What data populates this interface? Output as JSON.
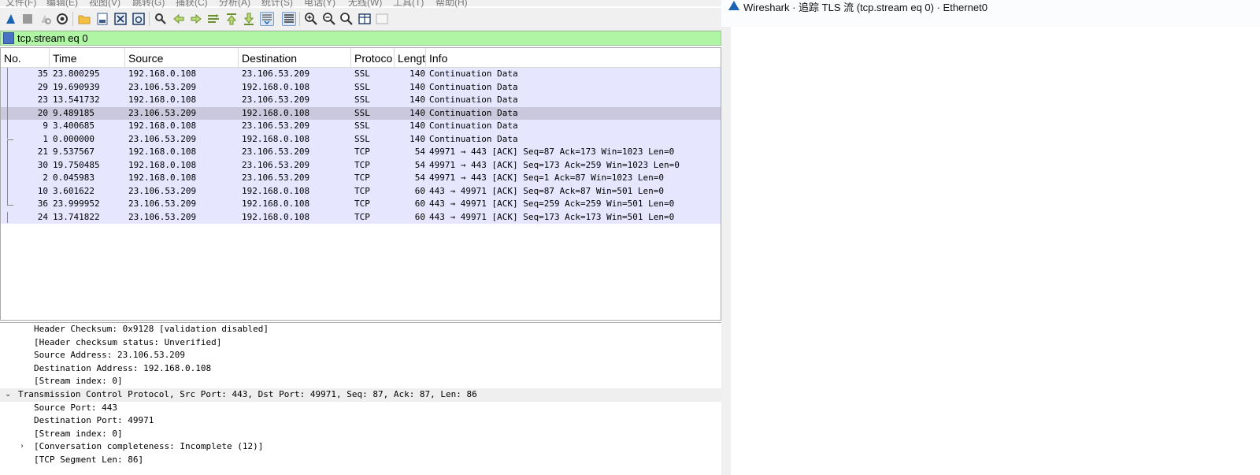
{
  "menubar": {
    "items": [
      "文件(F)",
      "编辑(E)",
      "视图(V)",
      "跳转(G)",
      "捕获(C)",
      "分析(A)",
      "统计(S)",
      "电话(Y)",
      "无线(W)",
      "工具(T)",
      "帮助(H)"
    ]
  },
  "toolbar": {
    "icons": [
      "start-capture-icon",
      "stop-capture-icon",
      "restart-capture-icon",
      "capture-options-icon",
      "open-file-icon",
      "save-file-icon",
      "close-file-icon",
      "reload-file-icon",
      "find-packet-icon",
      "go-back-icon",
      "go-forward-icon",
      "go-to-packet-icon",
      "go-first-icon",
      "go-last-icon",
      "autoscroll-icon",
      "colorize-icon",
      "zoom-in-icon",
      "zoom-out-icon",
      "zoom-normal-icon",
      "resize-columns-icon"
    ]
  },
  "filter": {
    "value": "tcp.stream eq 0"
  },
  "packet_list": {
    "columns": [
      "No.",
      "Time",
      "Source",
      "Destination",
      "Protoco",
      "Lengt",
      "Info"
    ],
    "rows": [
      {
        "no": "35",
        "time": "23.800295",
        "src": "192.168.0.108",
        "dst": "23.106.53.209",
        "proto": "SSL",
        "len": "140",
        "info": "Continuation Data"
      },
      {
        "no": "29",
        "time": "19.690939",
        "src": "23.106.53.209",
        "dst": "192.168.0.108",
        "proto": "SSL",
        "len": "140",
        "info": "Continuation Data"
      },
      {
        "no": "23",
        "time": "13.541732",
        "src": "192.168.0.108",
        "dst": "23.106.53.209",
        "proto": "SSL",
        "len": "140",
        "info": "Continuation Data"
      },
      {
        "no": "20",
        "time": "9.489185",
        "src": "23.106.53.209",
        "dst": "192.168.0.108",
        "proto": "SSL",
        "len": "140",
        "info": "Continuation Data"
      },
      {
        "no": "9",
        "time": "3.400685",
        "src": "192.168.0.108",
        "dst": "23.106.53.209",
        "proto": "SSL",
        "len": "140",
        "info": "Continuation Data"
      },
      {
        "no": "1",
        "time": "0.000000",
        "src": "23.106.53.209",
        "dst": "192.168.0.108",
        "proto": "SSL",
        "len": "140",
        "info": "Continuation Data"
      },
      {
        "no": "21",
        "time": "9.537567",
        "src": "192.168.0.108",
        "dst": "23.106.53.209",
        "proto": "TCP",
        "len": "54",
        "info": "49971 → 443 [ACK] Seq=87 Ack=173 Win=1023 Len=0"
      },
      {
        "no": "30",
        "time": "19.750485",
        "src": "192.168.0.108",
        "dst": "23.106.53.209",
        "proto": "TCP",
        "len": "54",
        "info": "49971 → 443 [ACK] Seq=173 Ack=259 Win=1023 Len=0"
      },
      {
        "no": "2",
        "time": "0.045983",
        "src": "192.168.0.108",
        "dst": "23.106.53.209",
        "proto": "TCP",
        "len": "54",
        "info": "49971 → 443 [ACK] Seq=1 Ack=87 Win=1023 Len=0"
      },
      {
        "no": "10",
        "time": "3.601622",
        "src": "23.106.53.209",
        "dst": "192.168.0.108",
        "proto": "TCP",
        "len": "60",
        "info": "443 → 49971 [ACK] Seq=87 Ack=87 Win=501 Len=0"
      },
      {
        "no": "36",
        "time": "23.999952",
        "src": "23.106.53.209",
        "dst": "192.168.0.108",
        "proto": "TCP",
        "len": "60",
        "info": "443 → 49971 [ACK] Seq=259 Ack=259 Win=501 Len=0"
      },
      {
        "no": "24",
        "time": "13.741822",
        "src": "23.106.53.209",
        "dst": "192.168.0.108",
        "proto": "TCP",
        "len": "60",
        "info": "443 → 49971 [ACK] Seq=173 Ack=173 Win=501 Len=0"
      }
    ],
    "selected_no": "20",
    "row_color": "#e7e6ff",
    "selected_color": "#c9c8dc"
  },
  "details": {
    "lines": [
      {
        "text": "Header Checksum: 0x9128 [validation disabled]",
        "level": 1,
        "expander": "none"
      },
      {
        "text": "[Header checksum status: Unverified]",
        "level": 1,
        "expander": "none"
      },
      {
        "text": "Source Address: 23.106.53.209",
        "level": 1,
        "expander": "none"
      },
      {
        "text": "Destination Address: 192.168.0.108",
        "level": 1,
        "expander": "none"
      },
      {
        "text": "[Stream index: 0]",
        "level": 1,
        "expander": "none"
      },
      {
        "text": "Transmission Control Protocol, Src Port: 443, Dst Port: 49971, Seq: 87, Ack: 87, Len: 86",
        "level": 0,
        "expander": "expanded"
      },
      {
        "text": "Source Port: 443",
        "level": 1,
        "expander": "none"
      },
      {
        "text": "Destination Port: 49971",
        "level": 1,
        "expander": "none"
      },
      {
        "text": "[Stream index: 0]",
        "level": 1,
        "expander": "none"
      },
      {
        "text": "[Conversation completeness: Incomplete (12)]",
        "level": 1,
        "expander": "collapsed"
      },
      {
        "text": "[TCP Segment Len: 86]",
        "level": 1,
        "expander": "none"
      }
    ]
  },
  "follow_window": {
    "title": "Wireshark · 追踪 TLS 流 (tcp.stream eq 0) · Ethernet0"
  }
}
